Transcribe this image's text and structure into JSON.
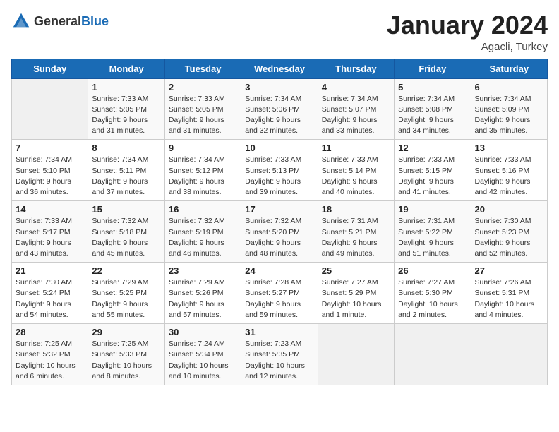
{
  "logo": {
    "general": "General",
    "blue": "Blue"
  },
  "header": {
    "month": "January 2024",
    "location": "Agacli, Turkey"
  },
  "weekdays": [
    "Sunday",
    "Monday",
    "Tuesday",
    "Wednesday",
    "Thursday",
    "Friday",
    "Saturday"
  ],
  "weeks": [
    [
      {
        "day": "",
        "info": ""
      },
      {
        "day": "1",
        "info": "Sunrise: 7:33 AM\nSunset: 5:05 PM\nDaylight: 9 hours\nand 31 minutes."
      },
      {
        "day": "2",
        "info": "Sunrise: 7:33 AM\nSunset: 5:05 PM\nDaylight: 9 hours\nand 31 minutes."
      },
      {
        "day": "3",
        "info": "Sunrise: 7:34 AM\nSunset: 5:06 PM\nDaylight: 9 hours\nand 32 minutes."
      },
      {
        "day": "4",
        "info": "Sunrise: 7:34 AM\nSunset: 5:07 PM\nDaylight: 9 hours\nand 33 minutes."
      },
      {
        "day": "5",
        "info": "Sunrise: 7:34 AM\nSunset: 5:08 PM\nDaylight: 9 hours\nand 34 minutes."
      },
      {
        "day": "6",
        "info": "Sunrise: 7:34 AM\nSunset: 5:09 PM\nDaylight: 9 hours\nand 35 minutes."
      }
    ],
    [
      {
        "day": "7",
        "info": "Sunrise: 7:34 AM\nSunset: 5:10 PM\nDaylight: 9 hours\nand 36 minutes."
      },
      {
        "day": "8",
        "info": "Sunrise: 7:34 AM\nSunset: 5:11 PM\nDaylight: 9 hours\nand 37 minutes."
      },
      {
        "day": "9",
        "info": "Sunrise: 7:34 AM\nSunset: 5:12 PM\nDaylight: 9 hours\nand 38 minutes."
      },
      {
        "day": "10",
        "info": "Sunrise: 7:33 AM\nSunset: 5:13 PM\nDaylight: 9 hours\nand 39 minutes."
      },
      {
        "day": "11",
        "info": "Sunrise: 7:33 AM\nSunset: 5:14 PM\nDaylight: 9 hours\nand 40 minutes."
      },
      {
        "day": "12",
        "info": "Sunrise: 7:33 AM\nSunset: 5:15 PM\nDaylight: 9 hours\nand 41 minutes."
      },
      {
        "day": "13",
        "info": "Sunrise: 7:33 AM\nSunset: 5:16 PM\nDaylight: 9 hours\nand 42 minutes."
      }
    ],
    [
      {
        "day": "14",
        "info": "Sunrise: 7:33 AM\nSunset: 5:17 PM\nDaylight: 9 hours\nand 43 minutes."
      },
      {
        "day": "15",
        "info": "Sunrise: 7:32 AM\nSunset: 5:18 PM\nDaylight: 9 hours\nand 45 minutes."
      },
      {
        "day": "16",
        "info": "Sunrise: 7:32 AM\nSunset: 5:19 PM\nDaylight: 9 hours\nand 46 minutes."
      },
      {
        "day": "17",
        "info": "Sunrise: 7:32 AM\nSunset: 5:20 PM\nDaylight: 9 hours\nand 48 minutes."
      },
      {
        "day": "18",
        "info": "Sunrise: 7:31 AM\nSunset: 5:21 PM\nDaylight: 9 hours\nand 49 minutes."
      },
      {
        "day": "19",
        "info": "Sunrise: 7:31 AM\nSunset: 5:22 PM\nDaylight: 9 hours\nand 51 minutes."
      },
      {
        "day": "20",
        "info": "Sunrise: 7:30 AM\nSunset: 5:23 PM\nDaylight: 9 hours\nand 52 minutes."
      }
    ],
    [
      {
        "day": "21",
        "info": "Sunrise: 7:30 AM\nSunset: 5:24 PM\nDaylight: 9 hours\nand 54 minutes."
      },
      {
        "day": "22",
        "info": "Sunrise: 7:29 AM\nSunset: 5:25 PM\nDaylight: 9 hours\nand 55 minutes."
      },
      {
        "day": "23",
        "info": "Sunrise: 7:29 AM\nSunset: 5:26 PM\nDaylight: 9 hours\nand 57 minutes."
      },
      {
        "day": "24",
        "info": "Sunrise: 7:28 AM\nSunset: 5:27 PM\nDaylight: 9 hours\nand 59 minutes."
      },
      {
        "day": "25",
        "info": "Sunrise: 7:27 AM\nSunset: 5:29 PM\nDaylight: 10 hours\nand 1 minute."
      },
      {
        "day": "26",
        "info": "Sunrise: 7:27 AM\nSunset: 5:30 PM\nDaylight: 10 hours\nand 2 minutes."
      },
      {
        "day": "27",
        "info": "Sunrise: 7:26 AM\nSunset: 5:31 PM\nDaylight: 10 hours\nand 4 minutes."
      }
    ],
    [
      {
        "day": "28",
        "info": "Sunrise: 7:25 AM\nSunset: 5:32 PM\nDaylight: 10 hours\nand 6 minutes."
      },
      {
        "day": "29",
        "info": "Sunrise: 7:25 AM\nSunset: 5:33 PM\nDaylight: 10 hours\nand 8 minutes."
      },
      {
        "day": "30",
        "info": "Sunrise: 7:24 AM\nSunset: 5:34 PM\nDaylight: 10 hours\nand 10 minutes."
      },
      {
        "day": "31",
        "info": "Sunrise: 7:23 AM\nSunset: 5:35 PM\nDaylight: 10 hours\nand 12 minutes."
      },
      {
        "day": "",
        "info": ""
      },
      {
        "day": "",
        "info": ""
      },
      {
        "day": "",
        "info": ""
      }
    ]
  ]
}
